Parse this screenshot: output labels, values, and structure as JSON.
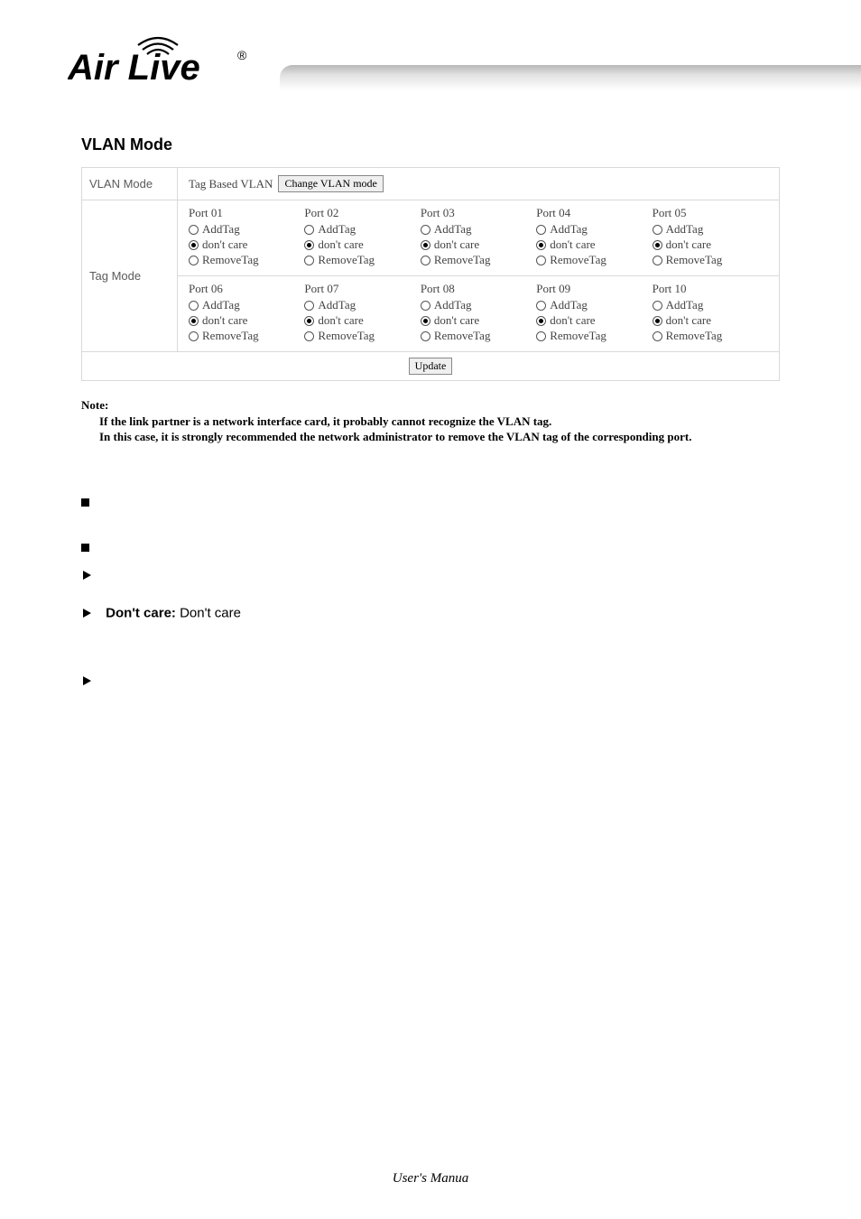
{
  "header": {
    "logo_text": "Air Live",
    "logo_mark": "®"
  },
  "section_title": "VLAN Mode",
  "panel": {
    "vlan_mode_label": "VLAN Mode",
    "vlan_mode_value": "Tag Based VLAN",
    "change_btn": "Change VLAN mode",
    "tag_mode_label": "Tag Mode",
    "options": {
      "add": "AddTag",
      "dont": "don't care",
      "remove": "RemoveTag"
    },
    "ports_row1": [
      {
        "name": "Port 01",
        "selected": "dont"
      },
      {
        "name": "Port 02",
        "selected": "dont"
      },
      {
        "name": "Port 03",
        "selected": "dont"
      },
      {
        "name": "Port 04",
        "selected": "dont"
      },
      {
        "name": "Port 05",
        "selected": "dont"
      }
    ],
    "ports_row2": [
      {
        "name": "Port 06",
        "selected": "dont"
      },
      {
        "name": "Port 07",
        "selected": "dont"
      },
      {
        "name": "Port 08",
        "selected": "dont"
      },
      {
        "name": "Port 09",
        "selected": "dont"
      },
      {
        "name": "Port 10",
        "selected": "dont"
      }
    ],
    "update_btn": "Update"
  },
  "note": {
    "title": "Note:",
    "line1": "If the link partner is a network interface card, it probably cannot recognize the VLAN tag.",
    "line2": "In this case, it is strongly recommended the network administrator to remove the VLAN tag of the corresponding port."
  },
  "body_text": {
    "dont_care_label": "Don't care:",
    "dont_care_text": " Don't care"
  },
  "footer": "User's Manua"
}
